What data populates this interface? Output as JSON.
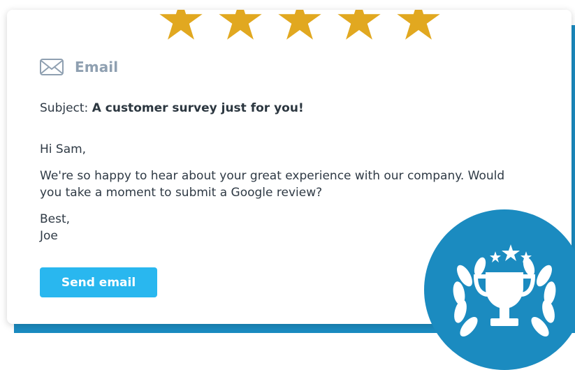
{
  "header": {
    "label": "Email"
  },
  "subject": {
    "label": "Subject:",
    "value": "A customer survey just for you!"
  },
  "email": {
    "greeting": "Hi Sam,",
    "message": "We're so happy to hear about your great experience with our company. Would you take a moment to submit a Google review?",
    "signoff_line1": "Best,",
    "signoff_line2": "Joe"
  },
  "actions": {
    "send_label": "Send email"
  },
  "rating": {
    "stars": 5
  },
  "colors": {
    "accent": "#29b7ef",
    "brand_blue": "#1b8bc0",
    "star_gold": "#e1a820",
    "muted_label": "#8fa0b1",
    "text": "#2f3a45"
  },
  "icons": {
    "envelope": "envelope-icon",
    "star": "star-icon",
    "trophy_badge": "trophy-badge-icon"
  }
}
